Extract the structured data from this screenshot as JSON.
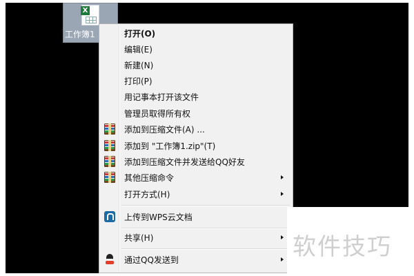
{
  "desktop": {
    "file": {
      "label": "工作簿1",
      "icon": "excel-file-icon"
    }
  },
  "context_menu": {
    "items": [
      {
        "label": "打开(O)",
        "bold": true
      },
      {
        "label": "编辑(E)"
      },
      {
        "label": "新建(N)"
      },
      {
        "label": "打印(P)"
      },
      {
        "label": "用记事本打开该文件"
      },
      {
        "label": "管理员取得所有权"
      },
      {
        "label": "添加到压缩文件(A) ...",
        "icon": "winrar-icon"
      },
      {
        "label": "添加到 \"工作簿1.zip\"(T)",
        "icon": "winrar-icon"
      },
      {
        "label": "添加到压缩文件并发送给QQ好友",
        "icon": "winrar-icon"
      },
      {
        "label": "其他压缩命令",
        "icon": "winrar-icon",
        "submenu": true
      },
      {
        "label": "打开方式(H)",
        "submenu": true
      },
      {
        "label": "上传到WPS云文档",
        "icon": "wps-cloud-icon"
      },
      {
        "label": "共享(H)",
        "submenu": true
      },
      {
        "label": "通过QQ发送到",
        "icon": "qq-penguin-icon",
        "submenu": true
      }
    ]
  },
  "watermark": {
    "text": "软件技巧"
  }
}
